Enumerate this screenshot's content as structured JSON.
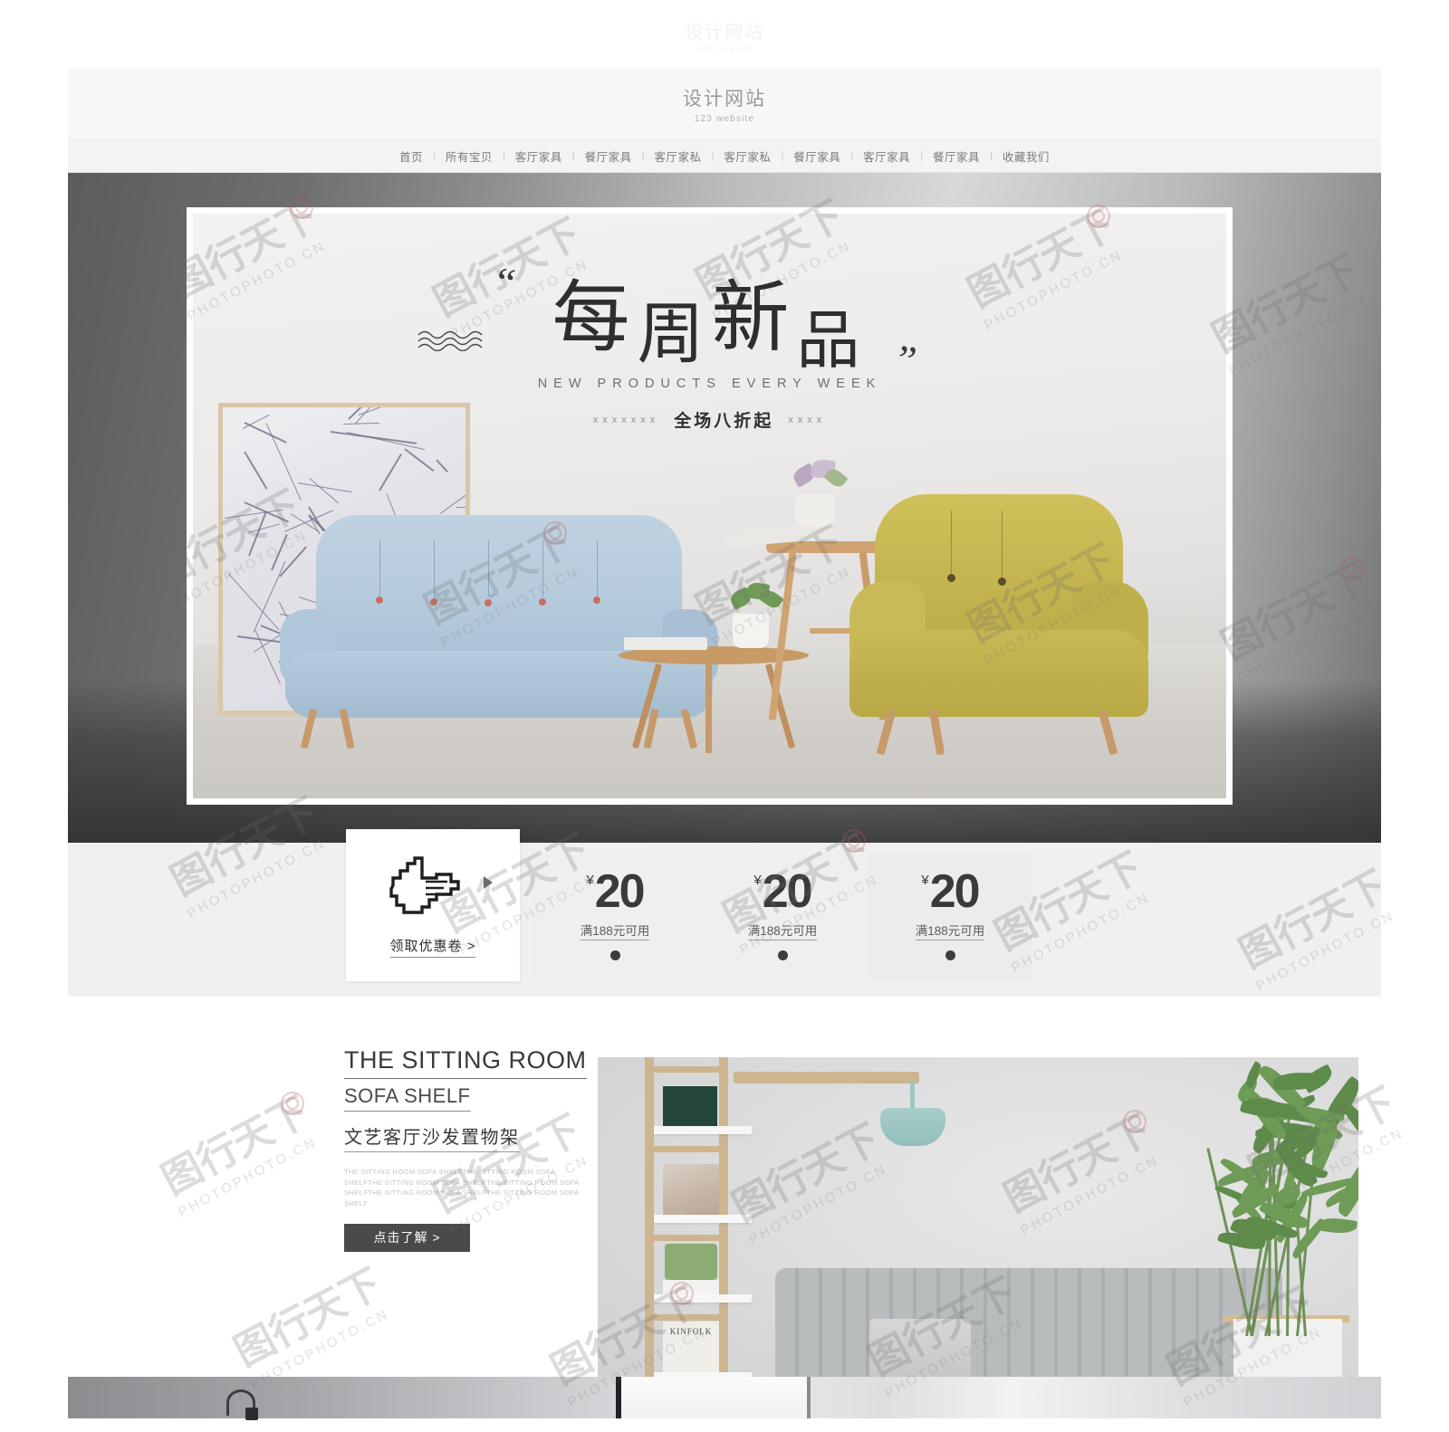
{
  "watermark": {
    "brand_cn": "图行天下",
    "brand_en": "PHOTOPHOTO.CN",
    "ghost_logo_cn": "设计网站",
    "ghost_logo_en": "123 website"
  },
  "header": {
    "logo_cn": "设计网站",
    "logo_en": "123 website"
  },
  "nav": {
    "items": [
      {
        "label": "首页"
      },
      {
        "label": "所有宝贝"
      },
      {
        "label": "客厅家具"
      },
      {
        "label": "餐厅家具"
      },
      {
        "label": "客厅家私"
      },
      {
        "label": "客厅家私"
      },
      {
        "label": "餐厅家具"
      },
      {
        "label": "客厅家具"
      },
      {
        "label": "餐厅家具"
      },
      {
        "label": "收藏我们"
      }
    ],
    "separator": "|"
  },
  "banner": {
    "title_chars": [
      "每",
      "周",
      "新",
      "品"
    ],
    "quote_open": "“",
    "quote_close": "”",
    "subtitle": "NEW PRODUCTS EVERY WEEK",
    "promo_text": "全场八折起",
    "promo_x_left": "xxxxxxx",
    "promo_x_right": "xxxx"
  },
  "coupon_section": {
    "card": {
      "label": "领取优惠卷",
      "chevron": ">",
      "icon": "pointing-hand-cursor"
    },
    "coupons": [
      {
        "currency": "¥",
        "amount": "20",
        "condition": "满188元可用"
      },
      {
        "currency": "¥",
        "amount": "20",
        "condition": "满188元可用"
      },
      {
        "currency": "¥",
        "amount": "20",
        "condition": "满188元可用"
      }
    ]
  },
  "sitting_room": {
    "title_en_1": "THE SITTING ROOM",
    "title_en_2": "SOFA SHELF",
    "title_cn": "文艺客厅沙发置物架",
    "description": "THE SITTING ROOM SOFA SHELFTHE SITTING ROOM SOFA SHELFTHE SITTING ROOM SOFA SHELFTHE SITTING ROOM SOFA SHELFTHE SITTING ROOM SOFA SHELFTHE SITTING ROOM SOFA SHELF",
    "button_label": "点击了解  >",
    "photo_items": {
      "magazine_title": "KINFOLK"
    }
  },
  "colors": {
    "page_background": "#ffffff",
    "header_background": "#f7f7f7",
    "nav_background": "#f3f3f3",
    "banner_dark": "#5a5c5e",
    "coupon_strip": "#f0f0f0",
    "coupon_tile": "#efefef",
    "button_dark": "#4a4a4a",
    "sofa_blue": "#b2c8da",
    "armchair_yellow": "#c4b44f",
    "text_primary": "#3a3a3a",
    "text_muted": "#9a9a9a"
  }
}
